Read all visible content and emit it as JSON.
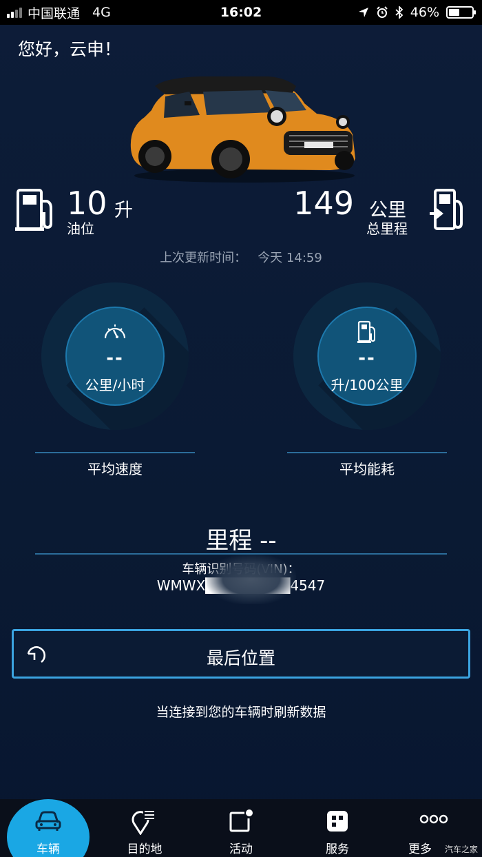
{
  "status_bar": {
    "carrier": "中国联通",
    "network": "4G",
    "time": "16:02",
    "battery": "46%",
    "battery_level": 0.46
  },
  "greeting": "您好，云申！",
  "fuel": {
    "value": "10",
    "unit": "升",
    "label": "油位"
  },
  "mileage_total": {
    "value": "149",
    "unit": "公里",
    "label": "总里程"
  },
  "last_update": {
    "label": "上次更新时间：",
    "time": "今天 14:59"
  },
  "gauges": [
    {
      "icon": "speedometer-icon",
      "value": "--",
      "unit": "公里/小时",
      "label": "平均速度"
    },
    {
      "icon": "fuel-pump-icon",
      "value": "--",
      "unit": "升/100公里",
      "label": "平均能耗"
    }
  ],
  "mileage": "里程 --",
  "vin": {
    "label": "车辆识别号码(VIN)：",
    "value": "WMWX████████4547"
  },
  "last_position_button": "最后位置",
  "refresh_note": "当连接到您的车辆时刷新数据",
  "nav": [
    {
      "label": "车辆",
      "icon": "car-icon",
      "active": true
    },
    {
      "label": "目的地",
      "icon": "destination-icon",
      "active": false
    },
    {
      "label": "活动",
      "icon": "activity-icon",
      "active": false
    },
    {
      "label": "服务",
      "icon": "services-icon",
      "active": false
    },
    {
      "label": "更多",
      "icon": "more-icon",
      "active": false
    }
  ],
  "watermark": "汽车之家",
  "colors": {
    "background": "#0b1a33",
    "accent": "#1aa7e4",
    "gauge_inner": "#115479",
    "car_body": "#e08a1e"
  }
}
